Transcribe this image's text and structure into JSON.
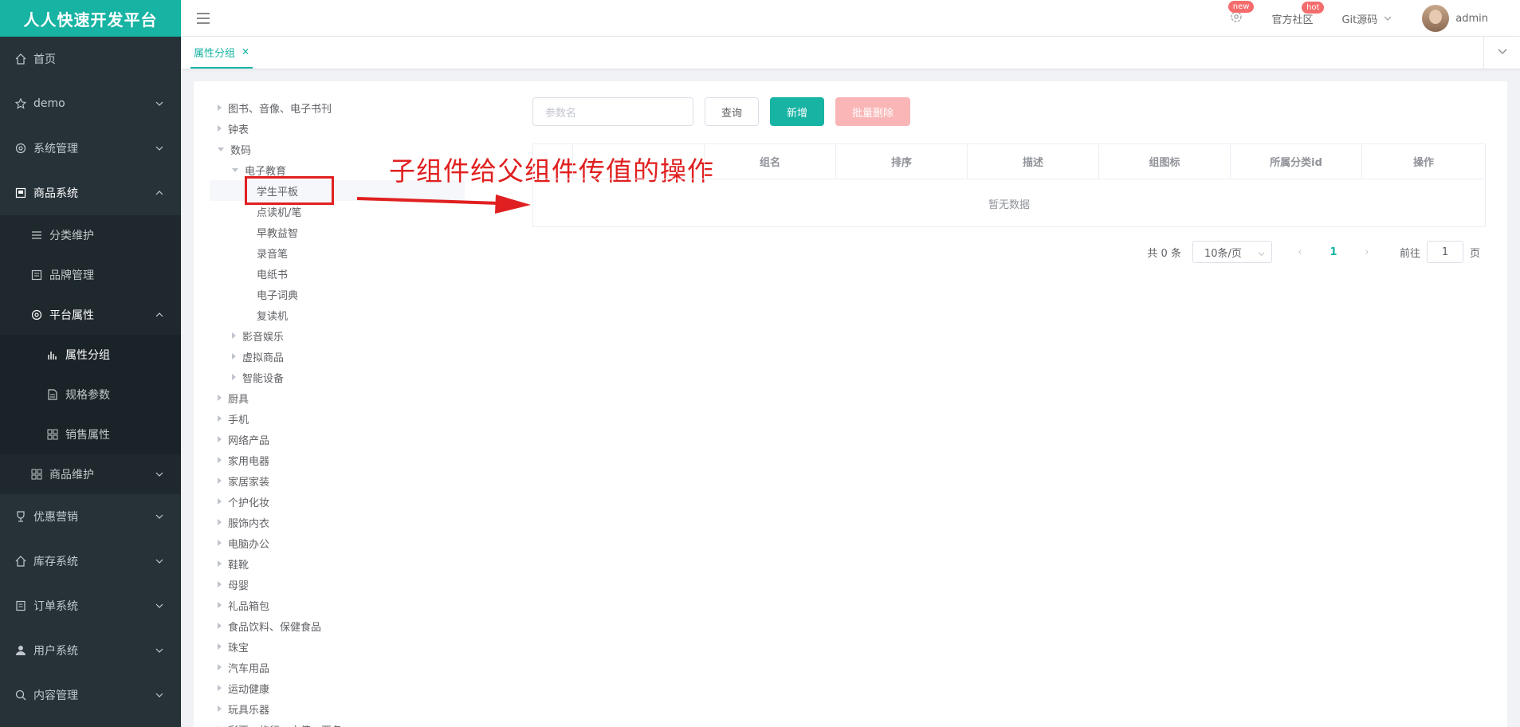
{
  "brand": "人人快速开发平台",
  "sidebar": {
    "items": [
      {
        "label": "首页",
        "icon": "home-icon"
      },
      {
        "label": "demo",
        "icon": "star-icon"
      },
      {
        "label": "系统管理",
        "icon": "gear-icon"
      },
      {
        "label": "商品系统",
        "icon": "goods-icon"
      },
      {
        "label": "分类维护",
        "icon": "list-icon"
      },
      {
        "label": "品牌管理",
        "icon": "brand-icon"
      },
      {
        "label": "平台属性",
        "icon": "gear-icon"
      },
      {
        "label": "属性分组",
        "icon": "chart-icon"
      },
      {
        "label": "规格参数",
        "icon": "doc-icon"
      },
      {
        "label": "销售属性",
        "icon": "grid-icon"
      },
      {
        "label": "商品维护",
        "icon": "grid-icon"
      },
      {
        "label": "优惠营销",
        "icon": "trophy-icon"
      },
      {
        "label": "库存系统",
        "icon": "home-icon"
      },
      {
        "label": "订单系统",
        "icon": "order-icon"
      },
      {
        "label": "用户系统",
        "icon": "user-icon"
      },
      {
        "label": "内容管理",
        "icon": "search-icon"
      }
    ]
  },
  "navbar": {
    "settings_badge": "new",
    "community": "官方社区",
    "community_badge": "hot",
    "git": "Git源码",
    "user": "admin"
  },
  "tabs": [
    {
      "label": "属性分组"
    }
  ],
  "tree": {
    "nodes": [
      {
        "label": "图书、音像、电子书刊",
        "level": 0,
        "state": "closed"
      },
      {
        "label": "钟表",
        "level": 0,
        "state": "closed"
      },
      {
        "label": "数码",
        "level": 0,
        "state": "open"
      },
      {
        "label": "电子教育",
        "level": 1,
        "state": "open"
      },
      {
        "label": "学生平板",
        "level": 2,
        "state": "leaf"
      },
      {
        "label": "点读机/笔",
        "level": 2,
        "state": "leaf"
      },
      {
        "label": "早教益智",
        "level": 2,
        "state": "leaf"
      },
      {
        "label": "录音笔",
        "level": 2,
        "state": "leaf"
      },
      {
        "label": "电纸书",
        "level": 2,
        "state": "leaf"
      },
      {
        "label": "电子词典",
        "level": 2,
        "state": "leaf"
      },
      {
        "label": "复读机",
        "level": 2,
        "state": "leaf"
      },
      {
        "label": "影音娱乐",
        "level": 1,
        "state": "closed"
      },
      {
        "label": "虚拟商品",
        "level": 1,
        "state": "closed"
      },
      {
        "label": "智能设备",
        "level": 1,
        "state": "closed"
      },
      {
        "label": "厨具",
        "level": 0,
        "state": "closed"
      },
      {
        "label": "手机",
        "level": 0,
        "state": "closed"
      },
      {
        "label": "网络产品",
        "level": 0,
        "state": "closed"
      },
      {
        "label": "家用电器",
        "level": 0,
        "state": "closed"
      },
      {
        "label": "家居家装",
        "level": 0,
        "state": "closed"
      },
      {
        "label": "个护化妆",
        "level": 0,
        "state": "closed"
      },
      {
        "label": "服饰内衣",
        "level": 0,
        "state": "closed"
      },
      {
        "label": "电脑办公",
        "level": 0,
        "state": "closed"
      },
      {
        "label": "鞋靴",
        "level": 0,
        "state": "closed"
      },
      {
        "label": "母婴",
        "level": 0,
        "state": "closed"
      },
      {
        "label": "礼品箱包",
        "level": 0,
        "state": "closed"
      },
      {
        "label": "食品饮料、保健食品",
        "level": 0,
        "state": "closed"
      },
      {
        "label": "珠宝",
        "level": 0,
        "state": "closed"
      },
      {
        "label": "汽车用品",
        "level": 0,
        "state": "closed"
      },
      {
        "label": "运动健康",
        "level": 0,
        "state": "closed"
      },
      {
        "label": "玩具乐器",
        "level": 0,
        "state": "closed"
      },
      {
        "label": "彩票、旅行、充值、票务",
        "level": 0,
        "state": "closed"
      }
    ]
  },
  "annotation": {
    "text": "子组件给父组件传值的操作",
    "color": "#e02020"
  },
  "form": {
    "search_placeholder": "参数名",
    "query": "查询",
    "add": "新增",
    "batch_delete": "批量删除"
  },
  "table": {
    "columns": [
      "",
      "",
      "组名",
      "排序",
      "描述",
      "组图标",
      "所属分类id",
      "操作"
    ],
    "empty_text": "暂无数据"
  },
  "pager": {
    "total": "共 0 条",
    "page_size": "10条/页",
    "current": "1",
    "goto_prefix": "前往",
    "goto_value": "1",
    "goto_suffix": "页"
  },
  "colors": {
    "accent": "#17b3a3",
    "sidebar": "#263238",
    "danger_light": "#fab6b6"
  }
}
